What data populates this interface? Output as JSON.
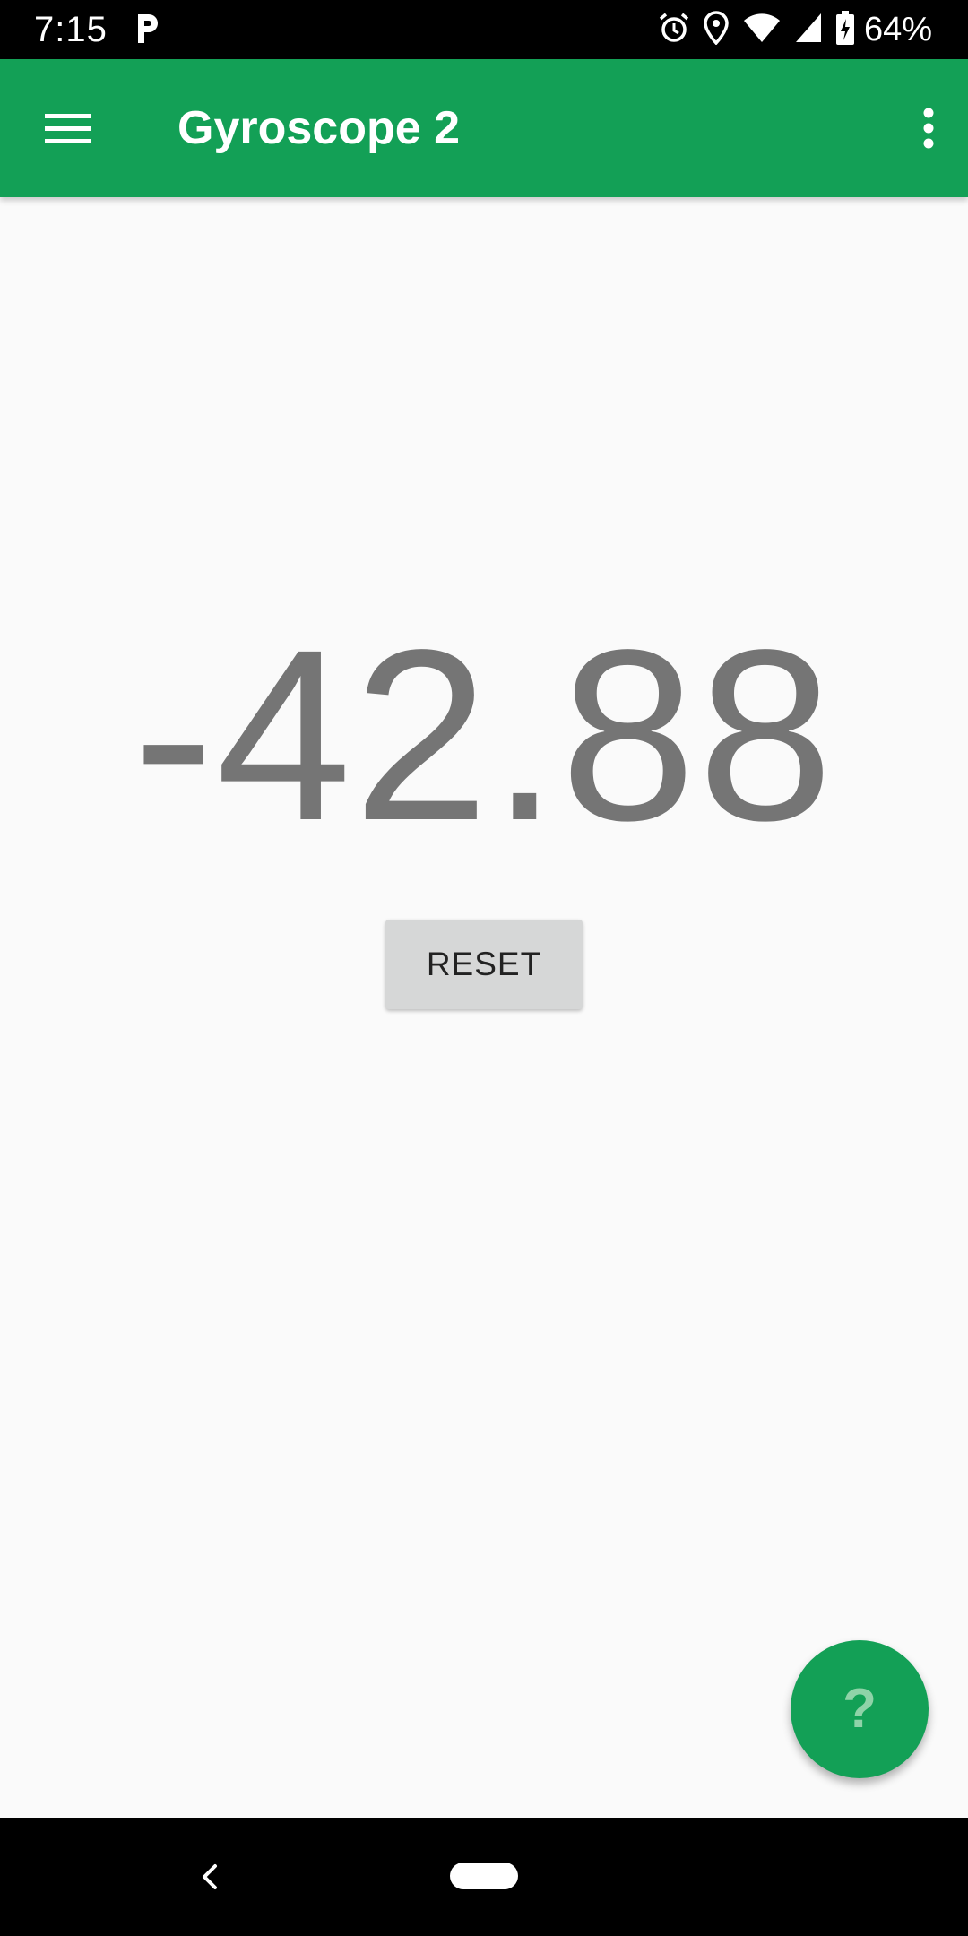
{
  "status_bar": {
    "time": "7:15",
    "battery": "64%",
    "icons": [
      "parking-notification-icon",
      "alarm-icon",
      "location-icon",
      "wifi-icon",
      "signal-icon",
      "battery-charging-icon"
    ]
  },
  "app_bar": {
    "title": "Gyroscope 2",
    "menu_icon": "hamburger-menu-icon",
    "overflow_icon": "more-vert-icon",
    "background": "#13a056"
  },
  "main": {
    "reading": "-42.88",
    "reset_label": "RESET",
    "reading_color": "#757575"
  },
  "fab": {
    "glyph": "?",
    "icon": "help-icon",
    "background": "#13a056"
  },
  "nav_bar": {
    "back_icon": "back-chevron-icon",
    "home_icon": "home-pill-icon"
  }
}
